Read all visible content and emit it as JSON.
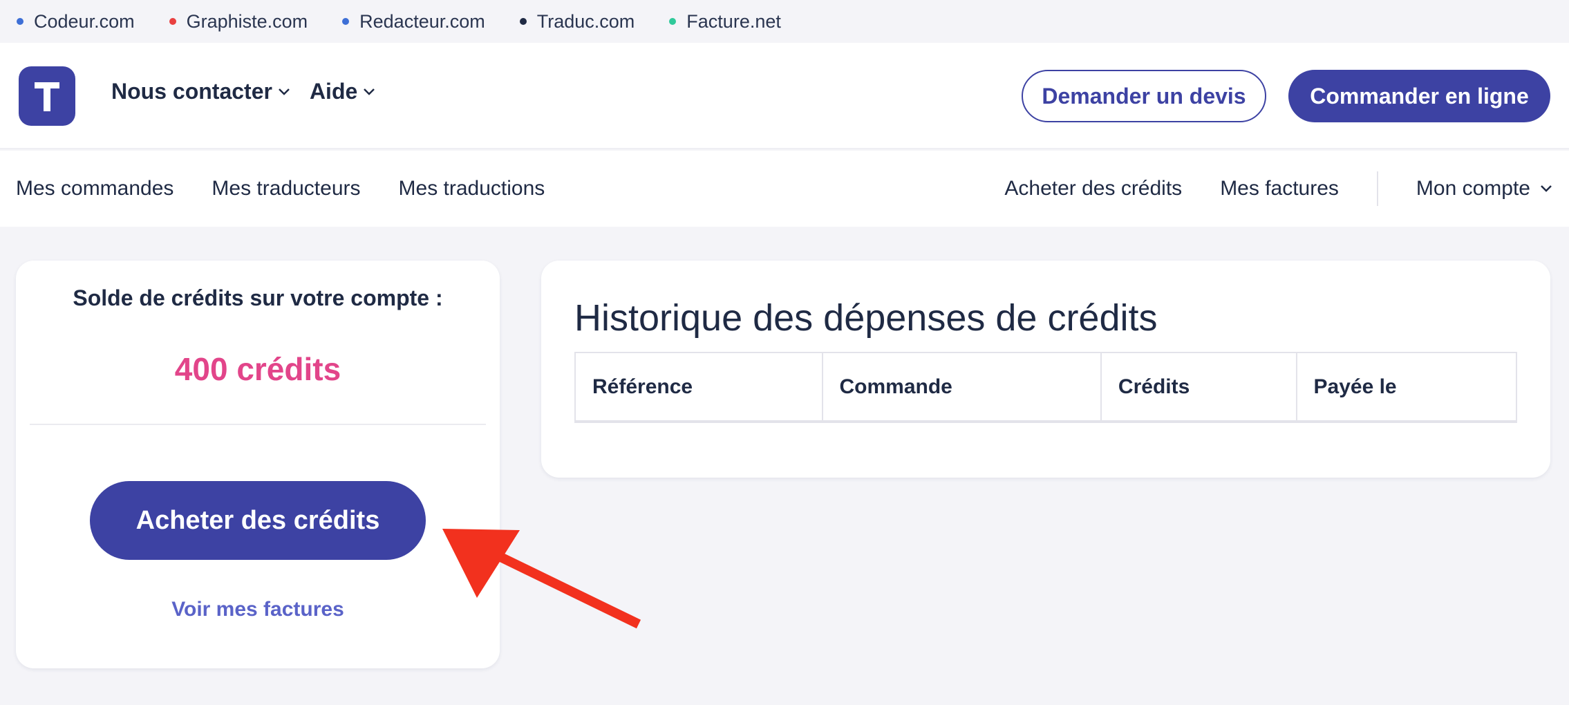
{
  "network": [
    {
      "label": "Codeur.com",
      "dot_color": "#3d6fd6"
    },
    {
      "label": "Graphiste.com",
      "dot_color": "#e94040"
    },
    {
      "label": "Redacteur.com",
      "dot_color": "#3d6fd6"
    },
    {
      "label": "Traduc.com",
      "dot_color": "#1f2a44"
    },
    {
      "label": "Facture.net",
      "dot_color": "#2fc99a"
    }
  ],
  "header": {
    "logo_letter": "T",
    "nav": [
      {
        "label": "Nous contacter"
      },
      {
        "label": "Aide"
      }
    ],
    "quote_button": "Demander un devis",
    "order_button": "Commander en ligne"
  },
  "subnav": {
    "left": [
      "Mes commandes",
      "Mes traducteurs",
      "Mes traductions"
    ],
    "right": [
      "Acheter des crédits",
      "Mes factures"
    ],
    "account": "Mon compte"
  },
  "balance": {
    "label": "Solde de crédits sur votre compte :",
    "value": "400 crédits",
    "buy_button": "Acheter des crédits",
    "invoices_link": "Voir mes factures"
  },
  "history": {
    "title": "Historique des dépenses de crédits",
    "columns": [
      "Référence",
      "Commande",
      "Crédits",
      "Payée le"
    ]
  },
  "colors": {
    "primary": "#3d42a3",
    "accent_pink": "#e2458a",
    "link": "#5a63c8",
    "annotation_arrow": "#f2311e"
  }
}
